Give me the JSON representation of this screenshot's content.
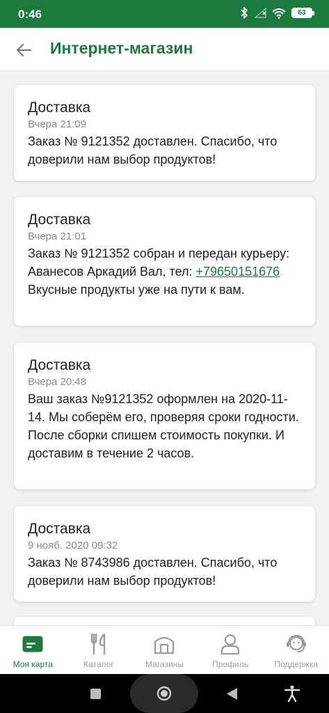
{
  "status": {
    "time": "0:46",
    "battery": "63"
  },
  "header": {
    "title": "Интернет-магазин"
  },
  "notifications": [
    {
      "title": "Доставка",
      "date": "Вчера 21:09",
      "text": "Заказ № 9121352 доставлен. Спасибо, что доверили нам выбор продуктов!"
    },
    {
      "title": "Доставка",
      "date": "Вчера 21:01",
      "text_before": "Заказ № 9121352 собран и передан курьеру: Аванесов Аркадий Вал, тел: ",
      "phone": "+79650151676",
      "text_after": " Вкусные продукты уже на пути к вам."
    },
    {
      "title": "Доставка",
      "date": "Вчера 20:48",
      "text": "Ваш заказ №9121352 оформлен на 2020-11-14. Мы соберём его, проверяя сроки годности. После сборки спишем стоимость покупки. И доставим в течение 2 часов."
    },
    {
      "title": "Доставка",
      "date": "9 нояб. 2020 09:32",
      "text": "Заказ № 8743986 доставлен. Спасибо, что доверили нам выбор продуктов!"
    }
  ],
  "bottom_nav": [
    {
      "label": "Моя карта",
      "icon": "card-icon",
      "active": true
    },
    {
      "label": "Каталог",
      "icon": "fork-knife-icon",
      "active": false
    },
    {
      "label": "Магазины",
      "icon": "store-icon",
      "active": false
    },
    {
      "label": "Профиль",
      "icon": "profile-icon",
      "active": false
    },
    {
      "label": "Поддержка",
      "icon": "support-icon",
      "active": false
    }
  ],
  "colors": {
    "brand": "#1b7a3d",
    "inactive": "#9a9a9a"
  }
}
